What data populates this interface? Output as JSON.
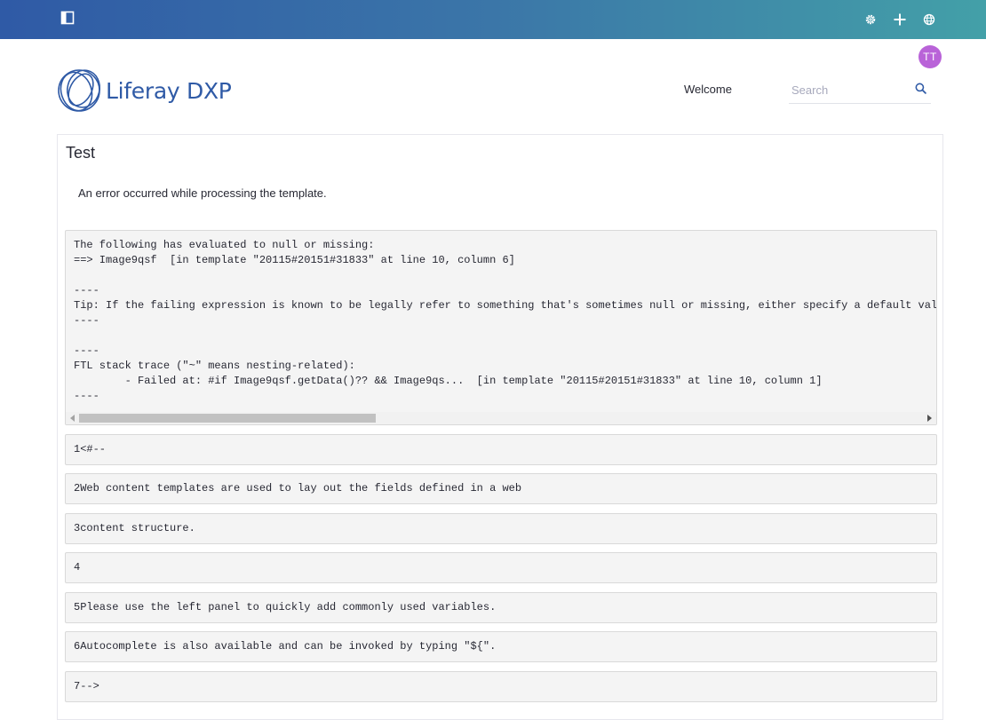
{
  "header": {
    "sidebar_toggle_icon": "sidebar-toggle-icon",
    "gear_icon": "gear-icon",
    "add_icon": "plus-icon",
    "globe_icon": "globe-icon"
  },
  "user": {
    "initials": "TT",
    "avatar_color": "#b963d8"
  },
  "site": {
    "logo_text": "Liferay DXP",
    "brand_color": "#2f5aa6"
  },
  "nav": {
    "welcome": "Welcome"
  },
  "search": {
    "placeholder": "Search",
    "value": ""
  },
  "portlet": {
    "title": "Test",
    "error_message": "An error occurred while processing the template.",
    "trace": "The following has evaluated to null or missing:\n==> Image9qsf  [in template \"20115#20151#31833\" at line 10, column 6]\n\n----\nTip: If the failing expression is known to be legally refer to something that's sometimes null or missing, either specify a default val\n----\n\n----\nFTL stack trace (\"~\" means nesting-related):\n\t- Failed at: #if Image9qsf.getData()?? && Image9qs...  [in template \"20115#20151#31833\" at line 10, column 1]\n----",
    "code_lines": [
      "1<#--",
      "2Web content templates are used to lay out the fields defined in a web",
      "3content structure.",
      "4",
      "5Please use the left panel to quickly add commonly used variables.",
      "6Autocomplete is also available and can be invoked by typing \"${\".",
      "7-->"
    ]
  }
}
